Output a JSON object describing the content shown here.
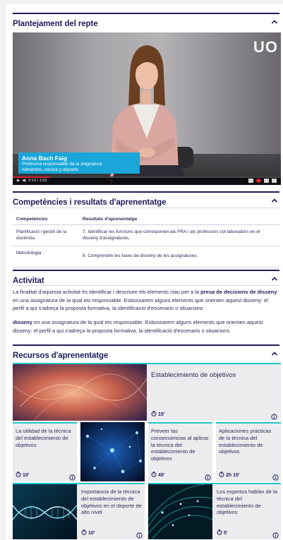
{
  "sections": {
    "video_title": "Plantejament del repte",
    "competences_title": "Competències i resultats d'aprenentatge",
    "activity_title": "Activitat",
    "resources_title": "Recursos d'aprenentatge"
  },
  "video": {
    "brand_mark": "UO",
    "caption_name": "Anna Bach Faig",
    "caption_role": "Profesora responsable de la asignatura",
    "caption_area": "Alimentos, cocina y deporte",
    "time": "0:16 / 1:52",
    "progress": 0.14,
    "colors": {
      "caption": "#1aa6d8",
      "progress": "#d9232b"
    }
  },
  "competences": {
    "headers": [
      "Competències",
      "Resultats d'aprenentatge"
    ],
    "rows": [
      [
        "Planificació i gestió de la docència",
        "7. Identificar les funcions que corresponen als PRA i als professors col·laboradors en el disseny d'assignatures."
      ],
      [
        "Metodologia",
        "8. Comprendre les fases de disseny de les assignatures."
      ]
    ]
  },
  "activity": {
    "p1_a": "La finalitat d'aquesta activitat és identificar i descriure els elements clau per a la ",
    "p1_bold": "presa de decisions de disseny",
    "p1_b": " en una assignatura de la qual ets responsable. Esbossarem alguns elements que orienten aquest disseny: el perfil a qui s'adreça la proposta formativa, la identificació d'escenaris o situacions",
    "p2_bold": "disseny",
    "p2_b": " en una assignatura de la qual ets responsable. Esbossarem alguns elements que orienten aquest disseny: el perfil a qui s'adreça la proposta formativa, la identificació d'escenaris o situacions"
  },
  "resources": [
    {
      "title": "Establecimiento de objetivos",
      "duration": "15'",
      "image": "abstract-energy-image"
    },
    {
      "title": "La utilidad de la técnica del establecimiento de objetivos",
      "duration": "10'",
      "image": "none"
    },
    {
      "title": "",
      "duration": "",
      "image": "network-nodes-image"
    },
    {
      "title": "Preveer las consecuencias al aplicar la técnica del establecimiento de objetivos",
      "duration": "45'",
      "image": "none"
    },
    {
      "title": "Aplicaciones prácticas de la técnica del establecimiento de objetivos",
      "duration": "2h 15'",
      "image": "none"
    },
    {
      "title": "Importancia de la técnica del establecimiento de objetivos en el deporte de alto nivel",
      "duration": "10'",
      "image": "dna-helix-image"
    },
    {
      "title": "Los expertos hablan de la técnica del establecimiento de objetivos",
      "duration": "5'",
      "image": "light-lines-image"
    }
  ],
  "colors": {
    "navy": "#1f1d5a",
    "accent": "#23c4c9"
  }
}
